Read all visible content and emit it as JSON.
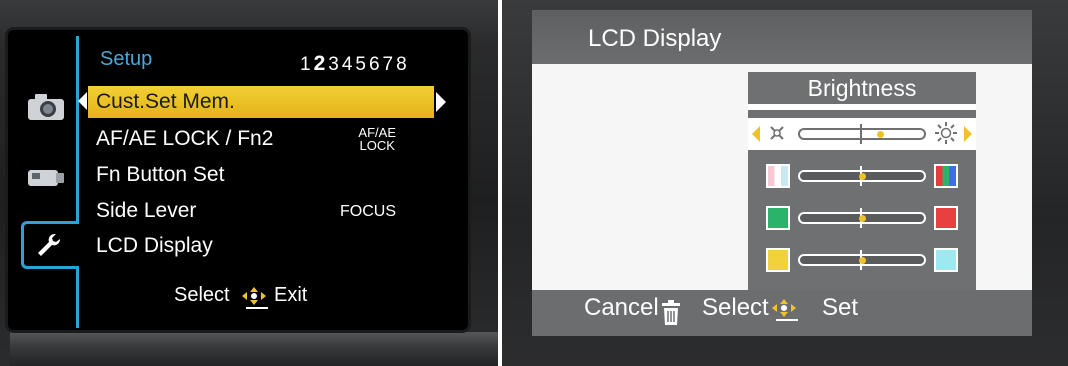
{
  "setup_menu": {
    "title": "Setup",
    "pages": {
      "prefix": "1",
      "current": "2",
      "suffix": "345678"
    },
    "tabs": [
      {
        "name": "camera-tab"
      },
      {
        "name": "video-tab"
      },
      {
        "name": "setup-tab",
        "active": true
      }
    ],
    "items": [
      {
        "label": "Cust.Set Mem.",
        "value": "",
        "selected": true
      },
      {
        "label": "AF/AE LOCK / Fn2",
        "value_line1": "AF/AE",
        "value_line2": "LOCK"
      },
      {
        "label": "Fn Button Set",
        "value": ""
      },
      {
        "label": "Side Lever",
        "value": "FOCUS"
      },
      {
        "label": "LCD Display",
        "value": ""
      }
    ],
    "guide": {
      "select": "Select",
      "exit": "Exit"
    }
  },
  "lcd_display": {
    "title": "LCD Display",
    "panel_title": "Brightness",
    "sliders": [
      {
        "name": "brightness",
        "level": 0.65,
        "active": true
      },
      {
        "name": "saturation",
        "level": 0.5
      },
      {
        "name": "red-green",
        "level": 0.5
      },
      {
        "name": "blue-yellow",
        "level": 0.5
      }
    ],
    "footer": {
      "cancel": "Cancel",
      "select": "Select",
      "set": "Set"
    },
    "colors": {
      "header": "#6a6b6d",
      "accent_yellow": "#f0c22a",
      "green": "#2bb36a",
      "red": "#e84040",
      "yellow": "#f2d23a",
      "cyan": "#9ee8f0"
    }
  }
}
